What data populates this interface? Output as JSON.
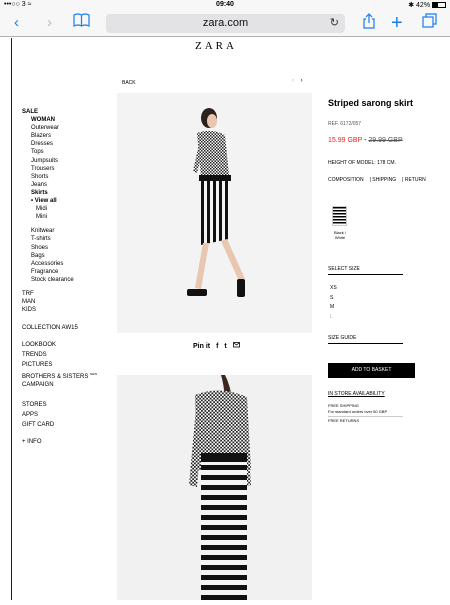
{
  "status": {
    "carrier": "•••○○ 3",
    "wifi": "≈",
    "time": "09:40",
    "bluetooth": "✱",
    "battery": "42%"
  },
  "browser": {
    "url": "zara.com"
  },
  "brand": "ZARA",
  "nav": {
    "sale": "SALE",
    "woman": "WOMAN",
    "woman_items": [
      "Outerwear",
      "Blazers",
      "Dresses",
      "Tops",
      "Jumpsuits",
      "Trousers",
      "Shorts",
      "Jeans"
    ],
    "skirts": "Skirts",
    "view_all": "View all",
    "skirt_items": [
      "Midi",
      "Mini"
    ],
    "more_items": [
      "Knitwear",
      "T-shirts",
      "Shoes",
      "Bags",
      "Accessories",
      "Fragrance",
      "Stock clearance"
    ],
    "trf": "TRF",
    "man": "MAN",
    "kids": "KIDS",
    "collection": "COLLECTION AW15",
    "lookbook": "LOOKBOOK",
    "trends": "TRENDS",
    "pictures": "PICTURES",
    "brothers": "BROTHERS & SISTERS",
    "new_badge": "NEW",
    "campaign": "CAMPAIGN",
    "stores": "STORES",
    "apps": "APPS",
    "gift": "GIFT CARD",
    "info": "+ INFO"
  },
  "gallery": {
    "back": "BACK",
    "prev": "‹",
    "next": "›"
  },
  "share": {
    "pinterest": "Pin it",
    "facebook": "f",
    "twitter": "t"
  },
  "product": {
    "title": "Striped sarong skirt",
    "ref": "REF. 6172/057",
    "price_new": "15.99 GBP",
    "price_sep": "-",
    "price_old": "29.99 GBP",
    "model_height": "HEIGHT OF MODEL: 178 CM.",
    "links": [
      "COMPOSITION",
      "SHIPPING",
      "RETURN"
    ],
    "color_name": "Black / White",
    "select_size": "SELECT SIZE",
    "sizes": [
      "XS",
      "S",
      "M",
      "L"
    ],
    "size_guide": "SIZE GUIDE",
    "add_to_basket": "ADD TO BASKET",
    "in_store": "IN STORE AVAILABILITY",
    "free_shipping": "FREE SHIPPING",
    "free_shipping_note": "For standard orders over 50 GBP",
    "free_returns": "FREE RETURNS"
  },
  "colors": {
    "accent": "#1b7cf2",
    "price": "#e1261c"
  }
}
